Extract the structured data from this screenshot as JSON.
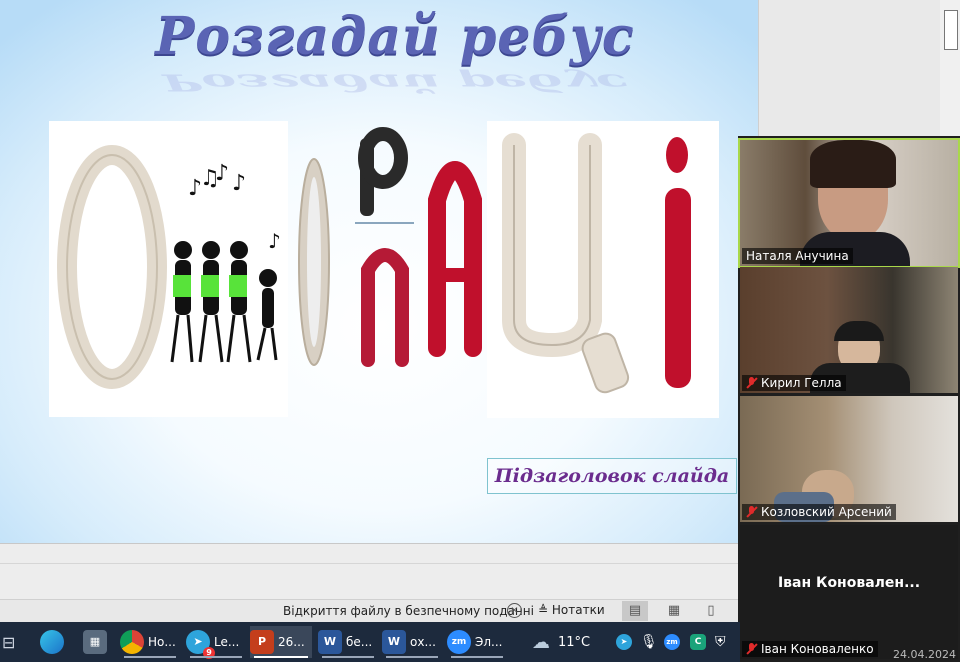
{
  "slide": {
    "title": "Розгадай ребус",
    "subtitle_placeholder": "Підзаголовок слайда",
    "rebus_letters": [
      "O",
      "O",
      "P",
      "п",
      "А",
      "Ц",
      "і"
    ]
  },
  "status_bar": {
    "safe_view": "Відкриття файлу в безпечному поданні",
    "notes": "Нотатки"
  },
  "participants": [
    {
      "name": "Наталя Анучина",
      "muted": false
    },
    {
      "name": "Кирил Гелла",
      "muted": true
    },
    {
      "name": "Козловский Арсений",
      "muted": true
    },
    {
      "name": "Іван Коноваленко",
      "muted": true,
      "display_name": "Іван  Коновален..."
    }
  ],
  "taskbar": {
    "items": [
      {
        "icon": "chrome-icon",
        "label": "Но..."
      },
      {
        "icon": "telegram-icon",
        "label": "Le...",
        "badge": "9"
      },
      {
        "icon": "powerpoint-icon",
        "label": "26..."
      },
      {
        "icon": "word-icon",
        "label": "бе..."
      },
      {
        "icon": "word-icon",
        "label": "ох..."
      },
      {
        "icon": "zoom-icon",
        "label": "Эл..."
      }
    ],
    "weather": "11°C",
    "date": "24.04.2024"
  },
  "colors": {
    "title": "#5a64b4",
    "subtitle": "#6b2c8e",
    "plasticine_red": "#c0102c",
    "plasticine_beige": "#e6ded2",
    "taskbar": "#1d2a3d"
  }
}
